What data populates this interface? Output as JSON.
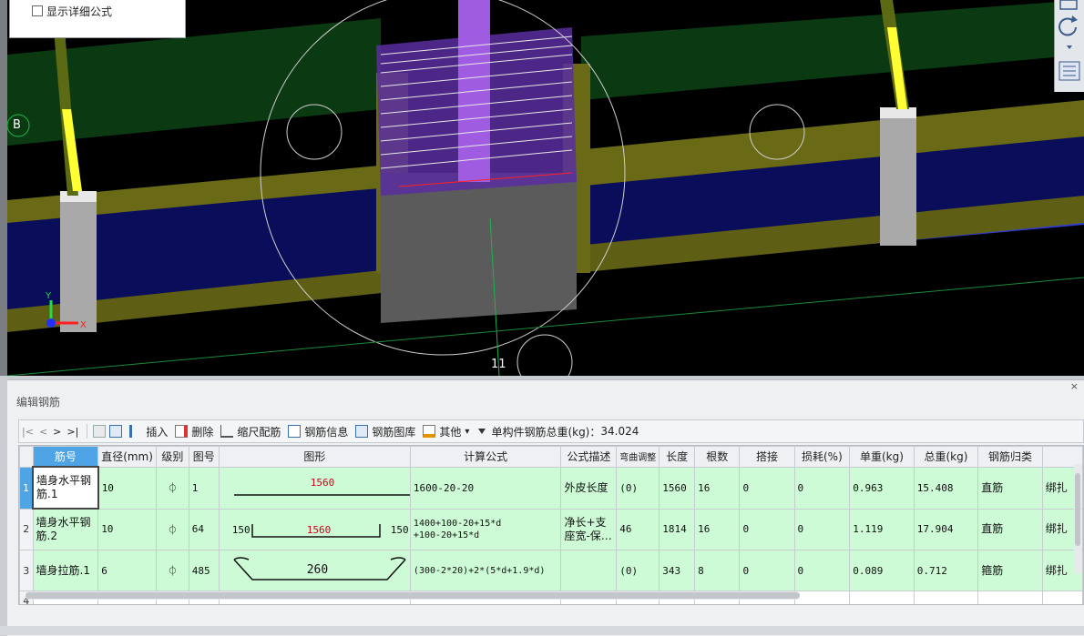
{
  "options": {
    "show_detail_formula": "显示详细公式"
  },
  "viewport": {
    "axis_label_b": "B",
    "axis_label_11": "11",
    "axis_y": "Y",
    "axis_x": "X"
  },
  "panel": {
    "title": "编辑钢筋",
    "close": "×"
  },
  "toolbar": {
    "nav": [
      "|<",
      "<",
      ">",
      ">|"
    ],
    "insert": "插入",
    "delete": "删除",
    "ruler": "缩尺配筋",
    "rebar_info": "钢筋信息",
    "rebar_library": "钢筋图库",
    "other": "其他",
    "other_arrow": "▾",
    "total_weight_label": "单构件钢筋总重(kg)：",
    "total_weight_value": "34.024"
  },
  "table": {
    "headers": [
      "筋号",
      "直径(mm)",
      "级别",
      "图号",
      "图形",
      "计算公式",
      "公式描述",
      "弯曲调整",
      "长度",
      "根数",
      "搭接",
      "损耗(%)",
      "单重(kg)",
      "总重(kg)",
      "钢筋归类",
      ""
    ],
    "rows": [
      {
        "rn": "1",
        "name": "墙身水平钢筋.1",
        "dia": "10",
        "grade": "⏀",
        "fig": "1",
        "shape": {
          "type": "straight",
          "mid": "1560"
        },
        "formula": "1600-20-20",
        "desc": "外皮长度",
        "bend": "(0)",
        "len": "1560",
        "count": "16",
        "lap": "0",
        "loss": "0",
        "unit": "0.963",
        "total": "15.408",
        "cat": "直筋",
        "extra": "绑扎"
      },
      {
        "rn": "2",
        "name": "墙身水平钢筋.2",
        "dia": "10",
        "grade": "⏀",
        "fig": "64",
        "shape": {
          "type": "hooked",
          "left": "150",
          "mid": "1560",
          "right": "150"
        },
        "formula": "1400+100-20+15*d\n+100-20+15*d",
        "desc": "净长+支座宽-保…",
        "bend": "46",
        "len": "1814",
        "count": "16",
        "lap": "0",
        "loss": "0",
        "unit": "1.119",
        "total": "17.904",
        "cat": "直筋",
        "extra": "绑扎"
      },
      {
        "rn": "3",
        "name": "墙身拉筋.1",
        "dia": "6",
        "grade": "⏀",
        "fig": "485",
        "shape": {
          "type": "tie",
          "mid": "260"
        },
        "formula": "(300-2*20)+2*(5*d+1.9*d)",
        "desc": "",
        "bend": "(0)",
        "len": "343",
        "count": "8",
        "lap": "0",
        "loss": "0",
        "unit": "0.089",
        "total": "0.712",
        "cat": "箍筋",
        "extra": "绑扎"
      },
      {
        "rn": "4"
      }
    ]
  },
  "colors": {
    "row_bg": "#cdfbd6",
    "header_highlight": "#4ea4e4",
    "shape_red": "#d0021b"
  }
}
